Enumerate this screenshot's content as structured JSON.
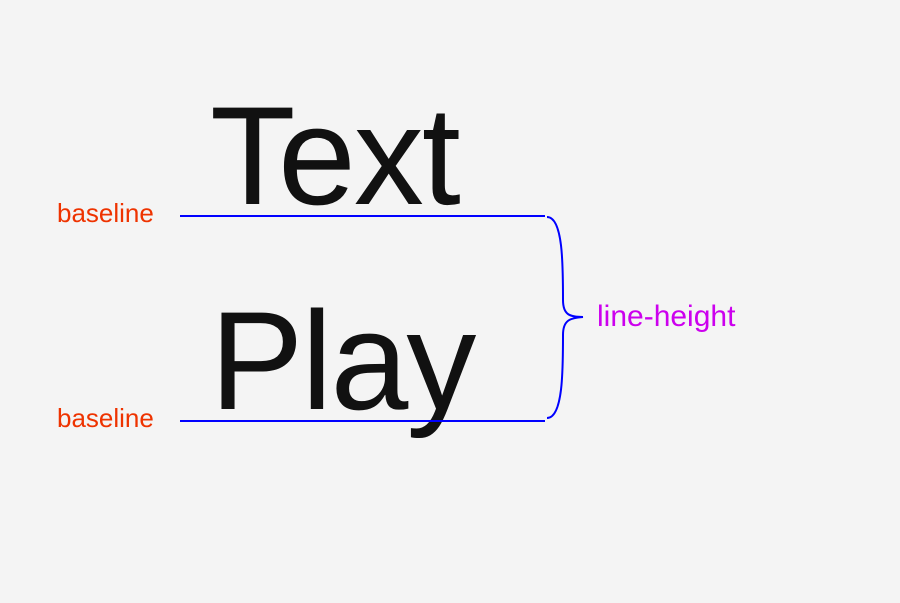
{
  "diagram": {
    "word1": "Text",
    "word2": "Play",
    "baseline_label_1": "baseline",
    "baseline_label_2": "baseline",
    "line_height_label": "line-height",
    "colors": {
      "baseline_line": "#0000ff",
      "baseline_label": "#ee3300",
      "line_height_label": "#cc00ee",
      "text": "#111111",
      "background": "#f4f4f4"
    }
  }
}
